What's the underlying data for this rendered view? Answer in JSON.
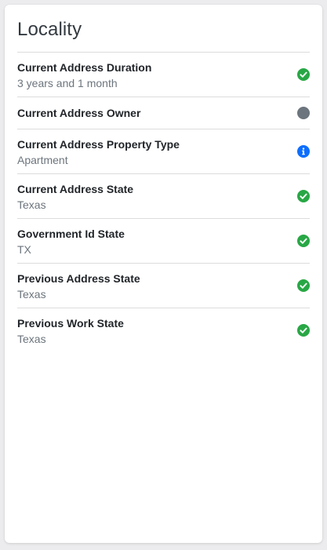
{
  "card": {
    "title": "Locality"
  },
  "colors": {
    "success": "#28a745",
    "neutral": "#6c757d",
    "info": "#0d6efd"
  },
  "items": [
    {
      "label": "Current Address Duration",
      "value": "3 years and 1 month",
      "status_icon": "check-circle-icon"
    },
    {
      "label": "Current Address Owner",
      "value": "",
      "status_icon": "gray-dot-icon"
    },
    {
      "label": "Current Address Property Type",
      "value": "Apartment",
      "status_icon": "info-circle-icon"
    },
    {
      "label": "Current Address State",
      "value": "Texas",
      "status_icon": "check-circle-icon"
    },
    {
      "label": "Government Id State",
      "value": "TX",
      "status_icon": "check-circle-icon"
    },
    {
      "label": "Previous Address State",
      "value": "Texas",
      "status_icon": "check-circle-icon"
    },
    {
      "label": "Previous Work State",
      "value": "Texas",
      "status_icon": "check-circle-icon"
    }
  ]
}
